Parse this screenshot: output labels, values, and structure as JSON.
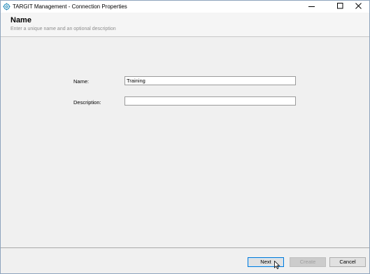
{
  "window": {
    "title": "TARGIT Management - Connection Properties"
  },
  "header": {
    "title": "Name",
    "subtitle": "Enter a unique name and an optional description"
  },
  "form": {
    "name_label": "Name:",
    "name_value": "Training",
    "description_label": "Description:",
    "description_value": ""
  },
  "buttons": {
    "next": "Next",
    "create": "Create",
    "cancel": "Cancel"
  },
  "colors": {
    "accent": "#0078d7",
    "window_bg": "#f0f0f0"
  }
}
